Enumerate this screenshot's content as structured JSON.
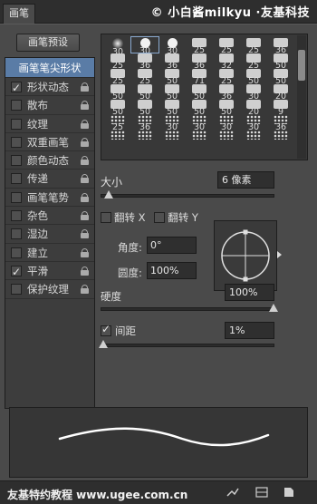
{
  "panel": {
    "tab_label": "画笔",
    "watermark": "© 小白酱milkyu ·友基科技"
  },
  "preset_button": "画笔预设",
  "left_list": {
    "header": "画笔笔尖形状",
    "items": [
      {
        "label": "形状动态",
        "checked": true
      },
      {
        "label": "散布",
        "checked": false
      },
      {
        "label": "纹理",
        "checked": false
      },
      {
        "label": "双重画笔",
        "checked": false
      },
      {
        "label": "颜色动态",
        "checked": false
      },
      {
        "label": "传递",
        "checked": false
      },
      {
        "label": "画笔笔势",
        "checked": false
      },
      {
        "label": "杂色",
        "checked": false
      },
      {
        "label": "湿边",
        "checked": false
      },
      {
        "label": "建立",
        "checked": false
      },
      {
        "label": "平滑",
        "checked": true
      },
      {
        "label": "保护纹理",
        "checked": false
      }
    ]
  },
  "brush_grid": {
    "rows": [
      [
        "30",
        "30",
        "30",
        "25",
        "25",
        "25",
        "36"
      ],
      [
        "25",
        "36",
        "36",
        "36",
        "32",
        "25",
        "50"
      ],
      [
        "25",
        "25",
        "50",
        "71",
        "25",
        "50",
        "50"
      ],
      [
        "50",
        "50",
        "50",
        "50",
        "36",
        "30",
        "20"
      ],
      [
        "50",
        "50",
        "50",
        "50",
        "50",
        "20",
        "9"
      ],
      [
        "25",
        "36",
        "30",
        "30",
        "30",
        "30",
        "36"
      ],
      [
        "",
        "",
        "",
        "",
        "",
        "",
        ""
      ]
    ]
  },
  "size": {
    "label": "大小",
    "value": "6 像素",
    "percent": 4
  },
  "flip": {
    "x_label": "翻转 X",
    "y_label": "翻转 Y"
  },
  "angle": {
    "label": "角度:",
    "value": "0°"
  },
  "roundness": {
    "label": "圆度:",
    "value": "100%"
  },
  "hardness": {
    "label": "硬度",
    "value": "100%",
    "percent": 100
  },
  "spacing": {
    "label": "间距",
    "value": "1%",
    "checked": true,
    "percent": 1
  },
  "footer": {
    "text": "友基特约教程  www.ugee.com.cn"
  }
}
